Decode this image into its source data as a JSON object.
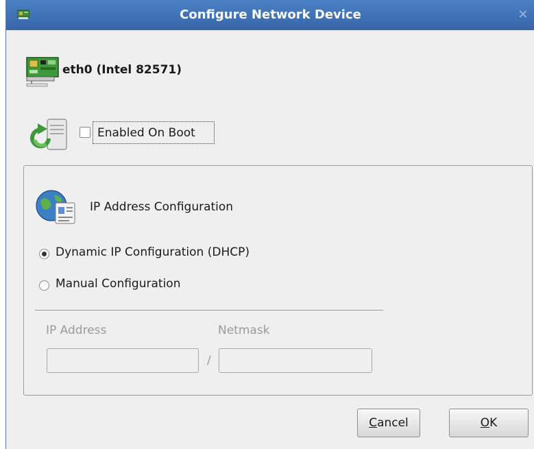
{
  "dialog": {
    "title": "Configure Network Device",
    "app_icon": "network-card-icon",
    "close_glyph": "✕"
  },
  "device": {
    "name": "eth0 (Intel 82571)",
    "icon": "network-card-icon"
  },
  "boot": {
    "label": "Enabled On Boot",
    "checked": false,
    "icon": "server-refresh-icon"
  },
  "ip_config": {
    "title": "IP Address Configuration",
    "icon": "globe-id-card-icon",
    "dhcp_label": "Dynamic IP Configuration (DHCP)",
    "dhcp_selected": true,
    "manual_label": "Manual Configuration",
    "manual_selected": false,
    "ip_label": "IP Address",
    "ip_value": "",
    "netmask_label": "Netmask",
    "netmask_value": "",
    "separator_glyph": "/"
  },
  "buttons": {
    "cancel_mnemonic": "C",
    "cancel_rest": "ancel",
    "ok_mnemonic": "O",
    "ok_rest": "K"
  },
  "colors": {
    "titlebar": "#3f73b6",
    "window_bg": "#efefef",
    "disabled_text": "#9a9a9a"
  }
}
